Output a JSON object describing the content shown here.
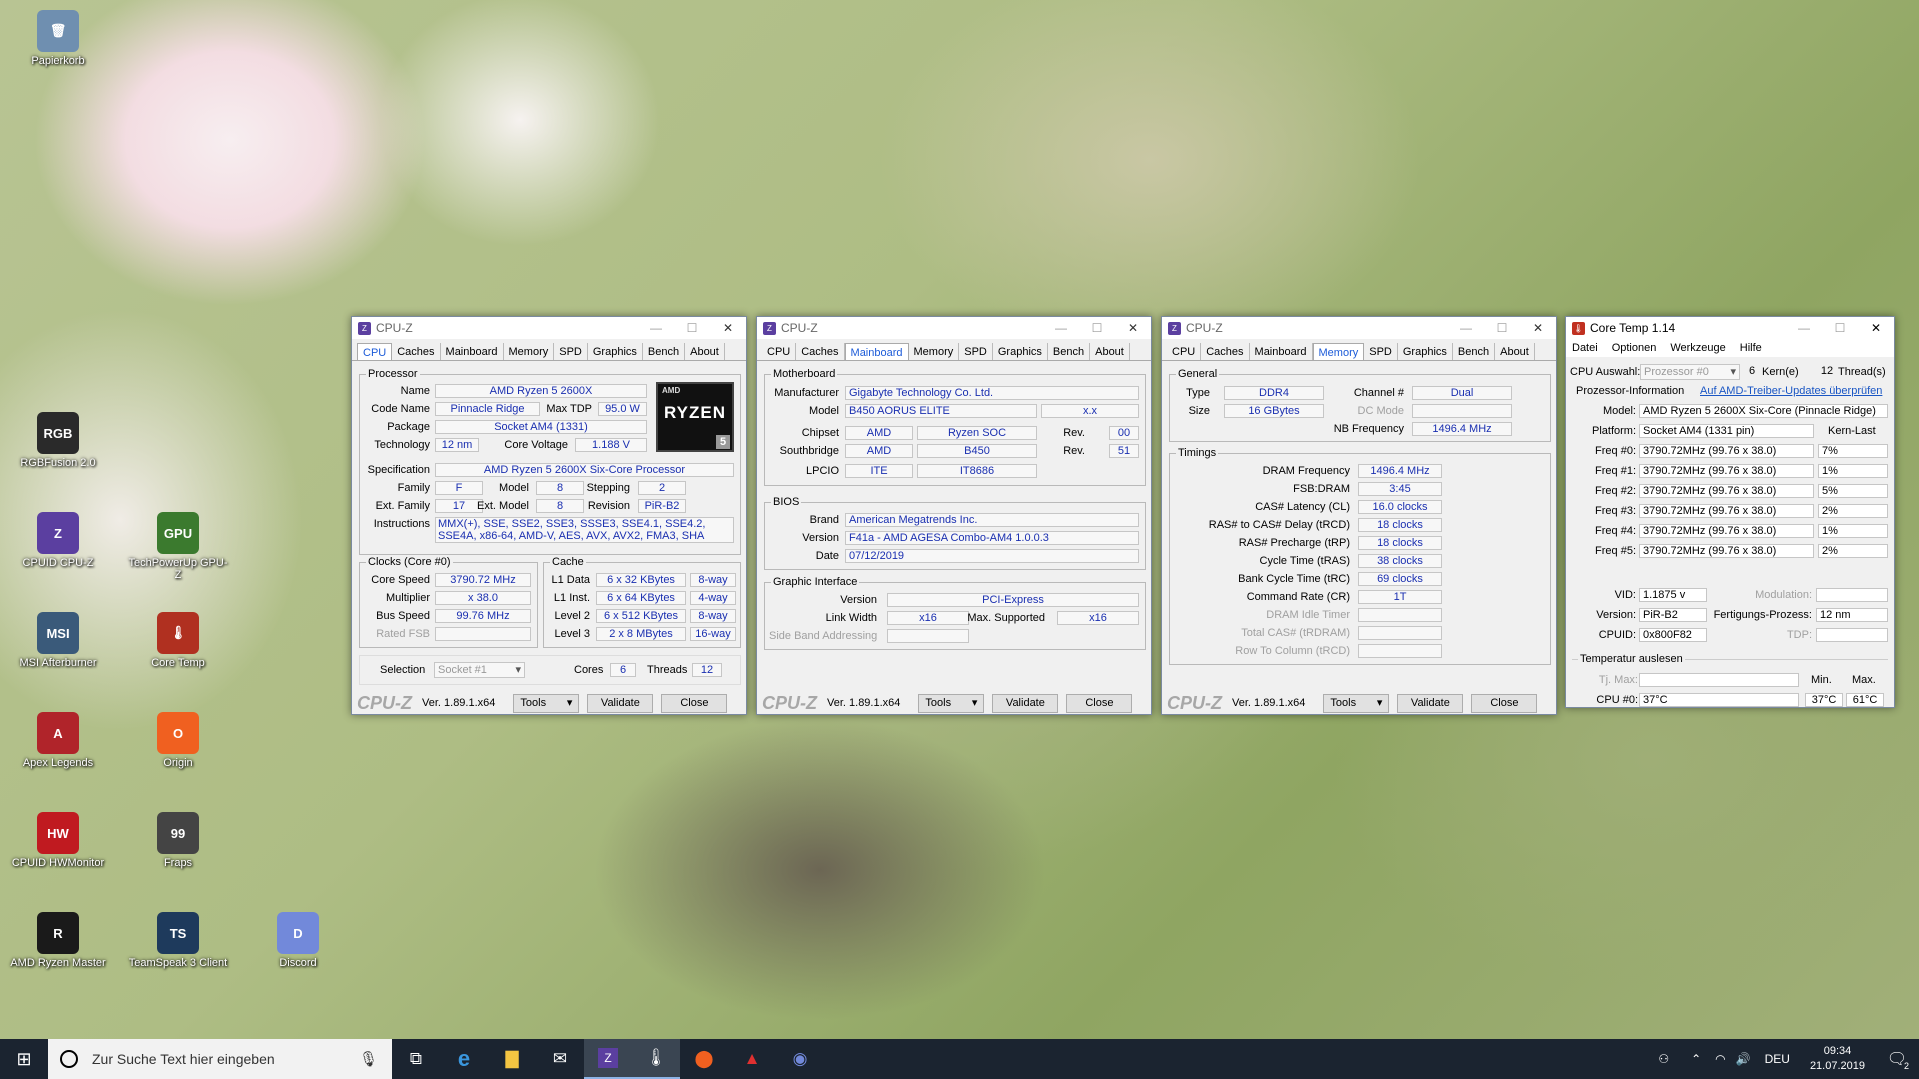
{
  "desktop": {
    "icons": [
      {
        "label": "Papierkorb",
        "glyph": "🗑",
        "bg": "#6f8fb0"
      },
      {
        "label": "RGBFusion 2.0",
        "glyph": "RGB",
        "bg": "#2a2a2a"
      },
      {
        "label": "CPUID CPU-Z",
        "glyph": "Z",
        "bg": "#5b3fa0"
      },
      {
        "label": "TechPowerUp GPU-Z",
        "glyph": "GPU",
        "bg": "#3b7a2e"
      },
      {
        "label": "MSI Afterburner",
        "glyph": "MSI",
        "bg": "#3a5a7a"
      },
      {
        "label": "Core Temp",
        "glyph": "🌡",
        "bg": "#b03020"
      },
      {
        "label": "Apex Legends",
        "glyph": "A",
        "bg": "#b0242a"
      },
      {
        "label": "Origin",
        "glyph": "O",
        "bg": "#f06020"
      },
      {
        "label": "CPUID HWMonitor",
        "glyph": "HW",
        "bg": "#c01a20"
      },
      {
        "label": "Fraps",
        "glyph": "99",
        "bg": "#444"
      },
      {
        "label": "AMD Ryzen Master",
        "glyph": "R",
        "bg": "#1a1a1a"
      },
      {
        "label": "TeamSpeak 3 Client",
        "glyph": "TS",
        "bg": "#1e3a5c"
      },
      {
        "label": "Discord",
        "glyph": "D",
        "bg": "#7289da"
      }
    ]
  },
  "cpuz_common": {
    "title": "CPU-Z",
    "tabs": [
      "CPU",
      "Caches",
      "Mainboard",
      "Memory",
      "SPD",
      "Graphics",
      "Bench",
      "About"
    ],
    "brand": "CPU-Z",
    "version": "Ver. 1.89.1.x64",
    "tools": "Tools",
    "validate": "Validate",
    "close": "Close"
  },
  "cpu": {
    "processor_group": "Processor",
    "name_lbl": "Name",
    "name": "AMD Ryzen 5 2600X",
    "codename_lbl": "Code Name",
    "codename": "Pinnacle Ridge",
    "maxtdp_lbl": "Max TDP",
    "maxtdp": "95.0 W",
    "package_lbl": "Package",
    "package": "Socket AM4 (1331)",
    "tech_lbl": "Technology",
    "tech": "12 nm",
    "voltage_lbl": "Core Voltage",
    "voltage": "1.188 V",
    "spec_lbl": "Specification",
    "spec": "AMD Ryzen 5 2600X Six-Core Processor",
    "family_lbl": "Family",
    "family": "F",
    "model_lbl": "Model",
    "model": "8",
    "stepping_lbl": "Stepping",
    "stepping": "2",
    "extfamily_lbl": "Ext. Family",
    "extfamily": "17",
    "extmodel_lbl": "Ext. Model",
    "extmodel": "8",
    "revision_lbl": "Revision",
    "revision": "PiR-B2",
    "instr_lbl": "Instructions",
    "instr": "MMX(+), SSE, SSE2, SSE3, SSSE3, SSE4.1, SSE4.2, SSE4A, x86-64, AMD-V, AES, AVX, AVX2, FMA3, SHA",
    "logo_top": "AMD",
    "logo_main": "RYZEN",
    "logo_num": "5",
    "clocks_group": "Clocks (Core #0)",
    "corespeed_lbl": "Core Speed",
    "corespeed": "3790.72 MHz",
    "mult_lbl": "Multiplier",
    "mult": "x 38.0",
    "bus_lbl": "Bus Speed",
    "bus": "99.76 MHz",
    "fsb_lbl": "Rated FSB",
    "cache_group": "Cache",
    "l1d_lbl": "L1 Data",
    "l1d": "6 x 32 KBytes",
    "l1d_way": "8-way",
    "l1i_lbl": "L1 Inst.",
    "l1i": "6 x 64 KBytes",
    "l1i_way": "4-way",
    "l2_lbl": "Level 2",
    "l2": "6 x 512 KBytes",
    "l2_way": "8-way",
    "l3_lbl": "Level 3",
    "l3": "2 x 8 MBytes",
    "l3_way": "16-way",
    "selection_lbl": "Selection",
    "selection": "Socket #1",
    "cores_lbl": "Cores",
    "cores": "6",
    "threads_lbl": "Threads",
    "threads": "12"
  },
  "mainboard": {
    "mb_group": "Motherboard",
    "manu_lbl": "Manufacturer",
    "manu": "Gigabyte Technology Co. Ltd.",
    "model_lbl": "Model",
    "model": "B450 AORUS ELITE",
    "model_rev": "x.x",
    "chipset_lbl": "Chipset",
    "chipset": "AMD",
    "chipset2": "Ryzen SOC",
    "chipset_rev_lbl": "Rev.",
    "chipset_rev": "00",
    "south_lbl": "Southbridge",
    "south": "AMD",
    "south2": "B450",
    "south_rev_lbl": "Rev.",
    "south_rev": "51",
    "lpcio_lbl": "LPCIO",
    "lpcio": "ITE",
    "lpcio2": "IT8686",
    "bios_group": "BIOS",
    "brand_lbl": "Brand",
    "brand": "American Megatrends Inc.",
    "version_lbl": "Version",
    "version": "F41a - AMD AGESA Combo-AM4 1.0.0.3",
    "date_lbl": "Date",
    "date": "07/12/2019",
    "gi_group": "Graphic Interface",
    "giver_lbl": "Version",
    "giver": "PCI-Express",
    "link_lbl": "Link Width",
    "link": "x16",
    "maxsup_lbl": "Max. Supported",
    "maxsup": "x16",
    "sideband_lbl": "Side Band Addressing"
  },
  "memory": {
    "general_group": "General",
    "type_lbl": "Type",
    "type": "DDR4",
    "channel_lbl": "Channel #",
    "channel": "Dual",
    "size_lbl": "Size",
    "size": "16 GBytes",
    "dcmode_lbl": "DC Mode",
    "nbfreq_lbl": "NB Frequency",
    "nbfreq": "1496.4 MHz",
    "timings_group": "Timings",
    "timings": [
      {
        "lbl": "DRAM Frequency",
        "val": "1496.4 MHz",
        "dim": false
      },
      {
        "lbl": "FSB:DRAM",
        "val": "3:45",
        "dim": false
      },
      {
        "lbl": "CAS# Latency (CL)",
        "val": "16.0 clocks",
        "dim": false
      },
      {
        "lbl": "RAS# to CAS# Delay (tRCD)",
        "val": "18 clocks",
        "dim": false
      },
      {
        "lbl": "RAS# Precharge (tRP)",
        "val": "18 clocks",
        "dim": false
      },
      {
        "lbl": "Cycle Time (tRAS)",
        "val": "38 clocks",
        "dim": false
      },
      {
        "lbl": "Bank Cycle Time (tRC)",
        "val": "69 clocks",
        "dim": false
      },
      {
        "lbl": "Command Rate (CR)",
        "val": "1T",
        "dim": false
      },
      {
        "lbl": "DRAM Idle Timer",
        "val": "",
        "dim": true
      },
      {
        "lbl": "Total CAS# (tRDRAM)",
        "val": "",
        "dim": true
      },
      {
        "lbl": "Row To Column (tRCD)",
        "val": "",
        "dim": true
      }
    ]
  },
  "coretemp": {
    "title": "Core Temp 1.14",
    "menu": [
      "Datei",
      "Optionen",
      "Werkzeuge",
      "Hilfe"
    ],
    "cpu_sel_lbl": "CPU Auswahl:",
    "cpu_sel": "Prozessor #0",
    "cores_num": "6",
    "cores_lbl": "Kern(e)",
    "threads_num": "12",
    "threads_lbl": "Thread(s)",
    "procinfo_lbl": "Prozessor-Information",
    "update_link": "Auf AMD-Treiber-Updates überprüfen",
    "model_lbl": "Model:",
    "model": "AMD Ryzen 5 2600X Six-Core (Pinnacle Ridge)",
    "platform_lbl": "Platform:",
    "platform": "Socket AM4 (1331 pin)",
    "load_hdr": "Kern-Last",
    "freqs": [
      {
        "lbl": "Freq #0:",
        "val": "3790.72MHz (99.76 x 38.0)",
        "load": "7%"
      },
      {
        "lbl": "Freq #1:",
        "val": "3790.72MHz (99.76 x 38.0)",
        "load": "1%"
      },
      {
        "lbl": "Freq #2:",
        "val": "3790.72MHz (99.76 x 38.0)",
        "load": "5%"
      },
      {
        "lbl": "Freq #3:",
        "val": "3790.72MHz (99.76 x 38.0)",
        "load": "2%"
      },
      {
        "lbl": "Freq #4:",
        "val": "3790.72MHz (99.76 x 38.0)",
        "load": "1%"
      },
      {
        "lbl": "Freq #5:",
        "val": "3790.72MHz (99.76 x 38.0)",
        "load": "2%"
      }
    ],
    "vid_lbl": "VID:",
    "vid": "1.1875 v",
    "modulation_lbl": "Modulation:",
    "version_lbl": "Version:",
    "version": "PiR-B2",
    "process_lbl": "Fertigungs-Prozess:",
    "process": "12 nm",
    "cpuid_lbl": "CPUID:",
    "cpuid": "0x800F82",
    "tdp_lbl": "TDP:",
    "temp_group": "Temperatur auslesen",
    "tjmax_lbl": "Tj. Max:",
    "min_lbl": "Min.",
    "max_lbl": "Max.",
    "cpu0_lbl": "CPU #0:",
    "cpu0": "37°C",
    "cpu0_min": "37°C",
    "cpu0_max": "61°C"
  },
  "taskbar": {
    "search_placeholder": "Zur Suche Text hier eingeben",
    "lang": "DEU",
    "time": "09:34",
    "date": "21.07.2019",
    "notif_count": "2"
  }
}
